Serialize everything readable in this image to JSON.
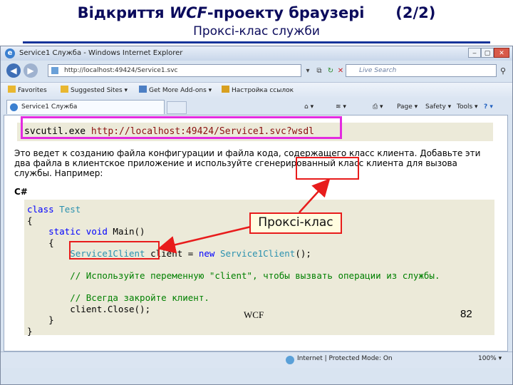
{
  "slide": {
    "title_prefix": "Відкриття ",
    "title_wcf": "WCF",
    "title_suffix": "-проекту браузері      (2/2)",
    "subtitle": "Проксі-клас служби"
  },
  "window": {
    "title": "Service1 Служба - Windows Internet Explorer",
    "address": "http://localhost:49424/Service1.svc",
    "search_placeholder": "Live Search"
  },
  "favorites": {
    "items": [
      "Favorites",
      "Suggested Sites ▾",
      "Get More Add-ons ▾",
      "Настройка ссылок"
    ]
  },
  "tab": {
    "label": "Service1 Служба"
  },
  "command_bar": [
    "Page ▾",
    "Safety ▾",
    "Tools ▾"
  ],
  "content": {
    "command_cmd": "svcutil.exe ",
    "command_url": "http://localhost:49424/Service1.svc?wsdl",
    "paragraph": "Это ведет к созданию файла конфигурации и файла кода, содержащего класс клиента. Добавьте эти два файла в клиентское приложение и используйте сгенерированный класс клиента для вызова службы. Например:",
    "language_label": "C#",
    "code": {
      "l1_kw": "class",
      "l1_ty": " Test",
      "l2": "{",
      "l3_kw1": "    static",
      "l3_kw2": " void",
      "l3_rest": " Main()",
      "l4": "    {",
      "l5_ty": "        Service1Client",
      "l5_mid": " client = ",
      "l5_kw": "new",
      "l5_ty2": " Service1Client",
      "l5_end": "();",
      "l6": "",
      "l7": "        // Используйте переменную \"client\", чтобы вызвать операции из службы.",
      "l8": "",
      "l9": "        // Всегда закройте клиент.",
      "l10": "        client.Close();",
      "l11": "    }",
      "l12": "}"
    }
  },
  "status": {
    "zone": "Internet | Protected Mode: On",
    "zoom": "100% ▾",
    "slide_label": "WCF",
    "page_number": "82"
  },
  "annotations": {
    "callout": "Проксі-клас"
  }
}
